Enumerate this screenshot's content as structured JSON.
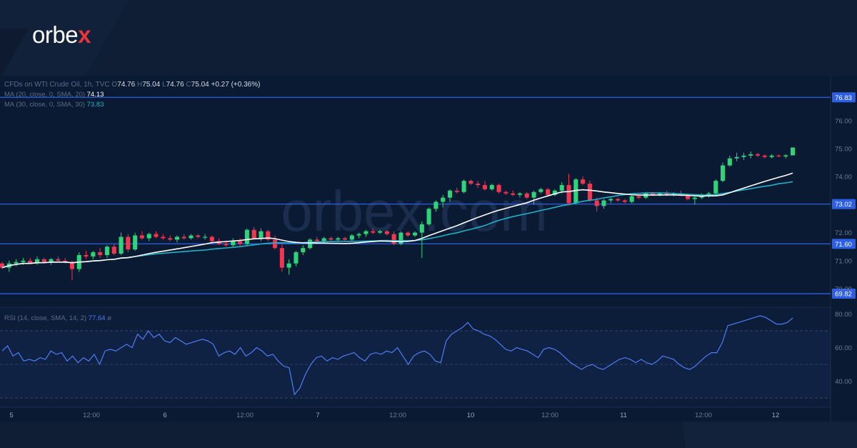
{
  "brand": {
    "name_prefix": "orbe",
    "name_suffix": "x",
    "watermark": "orbex.com"
  },
  "colors": {
    "background": "#101e35",
    "panel": "#0a1a33",
    "up": "#2fd37a",
    "down": "#f2364f",
    "ma20": "#ffffff",
    "ma30": "#22b1c9",
    "rsi": "#4d7cf4",
    "level_line": "#2d5fe6"
  },
  "legend": {
    "main": {
      "prefix": "CFDs on WTI Crude Oil, 1h, TVC",
      "open_label": "O",
      "open": "74.76",
      "high_label": "H",
      "high": "75.04",
      "low_label": "L",
      "low": "74.76",
      "close_label": "C",
      "close": "75.04",
      "change": "+0.27 (+0.36%)"
    },
    "ma20": {
      "label": "MA (20, close, 0, SMA, 20)",
      "value": "74.13"
    },
    "ma30": {
      "label": "MA (30, close, 0, SMA, 30)",
      "value": "73.83"
    },
    "rsi": {
      "label": "RSI (14, close, SMA, 14, 2)",
      "value": "77.64",
      "suffix": "ø"
    }
  },
  "chart_data": [
    {
      "type": "candlestick",
      "instrument": "CFDs on WTI Crude Oil",
      "timeframe": "1h",
      "y_ticks": [
        "70.00",
        "71.00",
        "72.00",
        "74.00",
        "75.00",
        "76.00"
      ],
      "ylim": [
        69.8,
        76.8
      ],
      "horizontal_levels": [
        76.83,
        73.02,
        71.6,
        69.82
      ],
      "x_ticks": [
        "5",
        "12:00",
        "6",
        "12:00",
        "7",
        "12:00",
        "10",
        "12:00",
        "11",
        "12:00",
        "12"
      ],
      "candles": [
        [
          70.9,
          70.95,
          70.7,
          70.75
        ],
        [
          70.75,
          71.0,
          70.6,
          70.9
        ],
        [
          70.9,
          71.05,
          70.8,
          70.95
        ],
        [
          70.95,
          71.1,
          70.85,
          71.0
        ],
        [
          71.0,
          71.1,
          70.9,
          70.9
        ],
        [
          70.9,
          71.15,
          70.85,
          71.05
        ],
        [
          71.05,
          71.1,
          70.9,
          70.95
        ],
        [
          70.95,
          71.1,
          70.85,
          71.05
        ],
        [
          71.05,
          71.15,
          70.95,
          71.0
        ],
        [
          71.0,
          71.1,
          70.9,
          70.95
        ],
        [
          70.95,
          71.0,
          70.3,
          70.7
        ],
        [
          70.7,
          71.3,
          70.6,
          71.2
        ],
        [
          71.2,
          71.35,
          71.05,
          71.15
        ],
        [
          71.15,
          71.35,
          71.05,
          71.3
        ],
        [
          71.3,
          71.45,
          71.1,
          71.2
        ],
        [
          71.2,
          71.55,
          71.1,
          71.5
        ],
        [
          71.5,
          71.6,
          71.2,
          71.25
        ],
        [
          71.25,
          72.0,
          71.2,
          71.85
        ],
        [
          71.85,
          71.95,
          71.3,
          71.4
        ],
        [
          71.4,
          72.0,
          71.35,
          71.9
        ],
        [
          71.9,
          72.05,
          71.75,
          71.8
        ],
        [
          71.8,
          72.0,
          71.7,
          71.95
        ],
        [
          71.95,
          72.05,
          71.8,
          71.85
        ],
        [
          71.85,
          71.95,
          71.75,
          71.8
        ],
        [
          71.8,
          71.9,
          71.7,
          71.75
        ],
        [
          71.75,
          71.9,
          71.65,
          71.85
        ],
        [
          71.85,
          71.95,
          71.75,
          71.8
        ],
        [
          71.8,
          71.95,
          71.75,
          71.9
        ],
        [
          71.9,
          71.95,
          71.8,
          71.85
        ],
        [
          71.85,
          71.95,
          71.75,
          71.85
        ],
        [
          71.85,
          71.9,
          71.65,
          71.7
        ],
        [
          71.7,
          71.8,
          71.55,
          71.6
        ],
        [
          71.6,
          71.7,
          71.5,
          71.55
        ],
        [
          71.55,
          71.8,
          71.5,
          71.7
        ],
        [
          71.7,
          71.8,
          71.5,
          71.6
        ],
        [
          71.6,
          72.15,
          71.55,
          72.1
        ],
        [
          72.1,
          72.2,
          71.75,
          71.8
        ],
        [
          71.8,
          72.15,
          71.7,
          72.05
        ],
        [
          72.05,
          72.1,
          71.7,
          71.75
        ],
        [
          71.75,
          71.9,
          71.4,
          71.45
        ],
        [
          71.45,
          71.6,
          70.6,
          70.75
        ],
        [
          70.75,
          71.05,
          70.5,
          70.9
        ],
        [
          70.9,
          71.35,
          70.8,
          71.3
        ],
        [
          71.3,
          71.55,
          71.2,
          71.45
        ],
        [
          71.45,
          71.8,
          71.4,
          71.75
        ],
        [
          71.75,
          71.85,
          71.6,
          71.7
        ],
        [
          71.7,
          71.85,
          71.6,
          71.8
        ],
        [
          71.8,
          71.85,
          71.7,
          71.75
        ],
        [
          71.75,
          71.85,
          71.7,
          71.8
        ],
        [
          71.8,
          71.85,
          71.7,
          71.75
        ],
        [
          71.75,
          71.95,
          71.7,
          71.9
        ],
        [
          71.9,
          72.0,
          71.8,
          71.95
        ],
        [
          71.95,
          72.1,
          71.85,
          72.05
        ],
        [
          72.05,
          72.15,
          71.95,
          72.0
        ],
        [
          72.0,
          72.1,
          71.95,
          72.05
        ],
        [
          72.05,
          72.1,
          71.9,
          71.95
        ],
        [
          71.95,
          72.05,
          71.55,
          71.6
        ],
        [
          71.6,
          72.05,
          71.55,
          72.0
        ],
        [
          72.0,
          72.05,
          71.85,
          71.9
        ],
        [
          71.9,
          72.05,
          71.85,
          72.0
        ],
        [
          72.0,
          72.4,
          71.1,
          72.3
        ],
        [
          72.3,
          72.9,
          72.25,
          72.85
        ],
        [
          72.85,
          73.15,
          72.75,
          73.1
        ],
        [
          73.1,
          73.35,
          72.9,
          73.25
        ],
        [
          73.25,
          73.55,
          73.1,
          73.5
        ],
        [
          73.5,
          73.6,
          73.4,
          73.45
        ],
        [
          73.45,
          73.9,
          73.4,
          73.85
        ],
        [
          73.85,
          73.9,
          73.7,
          73.75
        ],
        [
          73.75,
          73.85,
          73.6,
          73.7
        ],
        [
          73.7,
          73.85,
          73.5,
          73.55
        ],
        [
          73.55,
          73.75,
          73.5,
          73.7
        ],
        [
          73.7,
          73.75,
          73.4,
          73.45
        ],
        [
          73.45,
          73.5,
          73.35,
          73.4
        ],
        [
          73.4,
          73.5,
          73.3,
          73.35
        ],
        [
          73.35,
          73.45,
          73.25,
          73.4
        ],
        [
          73.4,
          73.45,
          73.2,
          73.25
        ],
        [
          73.25,
          73.5,
          73.0,
          73.45
        ],
        [
          73.45,
          73.6,
          73.4,
          73.55
        ],
        [
          73.55,
          73.6,
          73.3,
          73.35
        ],
        [
          73.35,
          73.55,
          73.3,
          73.5
        ],
        [
          73.5,
          73.8,
          73.4,
          73.7
        ],
        [
          73.7,
          74.1,
          73.0,
          73.05
        ],
        [
          73.05,
          73.95,
          73.0,
          73.9
        ],
        [
          73.9,
          74.0,
          73.7,
          73.75
        ],
        [
          73.75,
          73.85,
          73.1,
          73.15
        ],
        [
          73.15,
          73.25,
          72.75,
          72.95
        ],
        [
          72.95,
          73.2,
          72.85,
          73.15
        ],
        [
          73.15,
          73.25,
          73.05,
          73.2
        ],
        [
          73.2,
          73.25,
          73.1,
          73.15
        ],
        [
          73.15,
          73.2,
          73.05,
          73.1
        ],
        [
          73.1,
          73.35,
          73.05,
          73.3
        ],
        [
          73.3,
          73.35,
          73.2,
          73.25
        ],
        [
          73.25,
          73.45,
          73.2,
          73.4
        ],
        [
          73.4,
          73.45,
          73.3,
          73.35
        ],
        [
          73.35,
          73.45,
          73.3,
          73.4
        ],
        [
          73.4,
          73.5,
          73.3,
          73.35
        ],
        [
          73.35,
          73.45,
          73.3,
          73.4
        ],
        [
          73.4,
          73.5,
          73.3,
          73.35
        ],
        [
          73.35,
          73.4,
          73.15,
          73.2
        ],
        [
          73.2,
          73.3,
          73.0,
          73.25
        ],
        [
          73.25,
          73.4,
          73.2,
          73.35
        ],
        [
          73.35,
          73.45,
          73.25,
          73.4
        ],
        [
          73.4,
          73.9,
          73.35,
          73.85
        ],
        [
          73.85,
          74.5,
          73.8,
          74.4
        ],
        [
          74.4,
          74.75,
          74.35,
          74.65
        ],
        [
          74.65,
          74.85,
          74.55,
          74.7
        ],
        [
          74.7,
          74.85,
          74.6,
          74.75
        ],
        [
          74.75,
          74.9,
          74.65,
          74.8
        ],
        [
          74.8,
          74.85,
          74.7,
          74.75
        ],
        [
          74.75,
          74.8,
          74.65,
          74.7
        ],
        [
          74.7,
          74.8,
          74.65,
          74.75
        ],
        [
          74.75,
          74.8,
          74.7,
          74.72
        ],
        [
          74.72,
          74.8,
          74.65,
          74.76
        ],
        [
          74.76,
          75.04,
          74.76,
          75.04
        ]
      ],
      "rsi_ticks": [
        "40.00",
        "60.00",
        "80.00"
      ],
      "rsi_ylim": [
        27,
        84
      ],
      "rsi_levels": [
        70,
        50,
        30
      ],
      "rsi": [
        58,
        61,
        55,
        57,
        52,
        53,
        52,
        54,
        53,
        58,
        56,
        57,
        52,
        55,
        51,
        54,
        52,
        56,
        50,
        58,
        59,
        58,
        60,
        62,
        60,
        68,
        65,
        70,
        66,
        68,
        64,
        63,
        66,
        64,
        62,
        63,
        64,
        65,
        64,
        62,
        55,
        57,
        58,
        56,
        60,
        55,
        57,
        60,
        58,
        55,
        56,
        52,
        49,
        48,
        32,
        36,
        44,
        50,
        54,
        55,
        52,
        54,
        53,
        55,
        56,
        57,
        54,
        52,
        56,
        57,
        56,
        58,
        57,
        60,
        55,
        50,
        55,
        57,
        58,
        56,
        52,
        51,
        64,
        68,
        70,
        72,
        75,
        71,
        70,
        68,
        67,
        65,
        62,
        59,
        58,
        60,
        59,
        58,
        56,
        54,
        59,
        60,
        59,
        57,
        54,
        51,
        49,
        47,
        49,
        50,
        48,
        47,
        49,
        51,
        53,
        54,
        53,
        51,
        53,
        51,
        50,
        52,
        55,
        54,
        53,
        50,
        48,
        47,
        49,
        52,
        55,
        57,
        57,
        63,
        73,
        74,
        75,
        76,
        77,
        78,
        79,
        78,
        76,
        74,
        74,
        75,
        77.64
      ]
    }
  ]
}
